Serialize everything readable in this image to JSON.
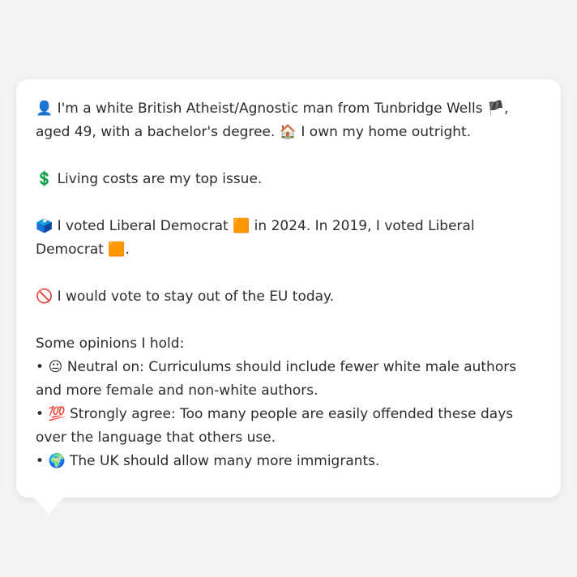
{
  "bubble": {
    "p1": {
      "person_icon": "👤",
      "text_a": " I'm a white British Atheist/Agnostic man from Tunbridge Wells ",
      "flag_icon": "🏴",
      "text_b": ", aged 49, with a bachelor's degree. ",
      "home_icon": "🏠",
      "text_c": " I own my home outright."
    },
    "p2": {
      "dollar_icon": "💲",
      "text": " Living costs are my top issue."
    },
    "p3": {
      "ballot_icon": "🗳️",
      "text_a": " I voted Liberal Democrat ",
      "square1_icon": "🟧",
      "text_b": " in 2024. In 2019, I voted Liberal Democrat ",
      "square2_icon": "🟧",
      "text_c": "."
    },
    "p4": {
      "no_icon": "🚫",
      "text": " I would vote to stay out of the EU today."
    },
    "opinions": {
      "heading": "Some opinions I hold:",
      "items": [
        {
          "bullet": "• ",
          "icon": "😐",
          "text": " Neutral on: Curriculums should include fewer white male authors and more female and non-white authors."
        },
        {
          "bullet": "• ",
          "icon": "💯",
          "text": " Strongly agree: Too many people are easily offended these days over the language that others use."
        },
        {
          "bullet": "• ",
          "icon": "🌍",
          "text": " The UK should allow many more immigrants."
        }
      ]
    }
  }
}
